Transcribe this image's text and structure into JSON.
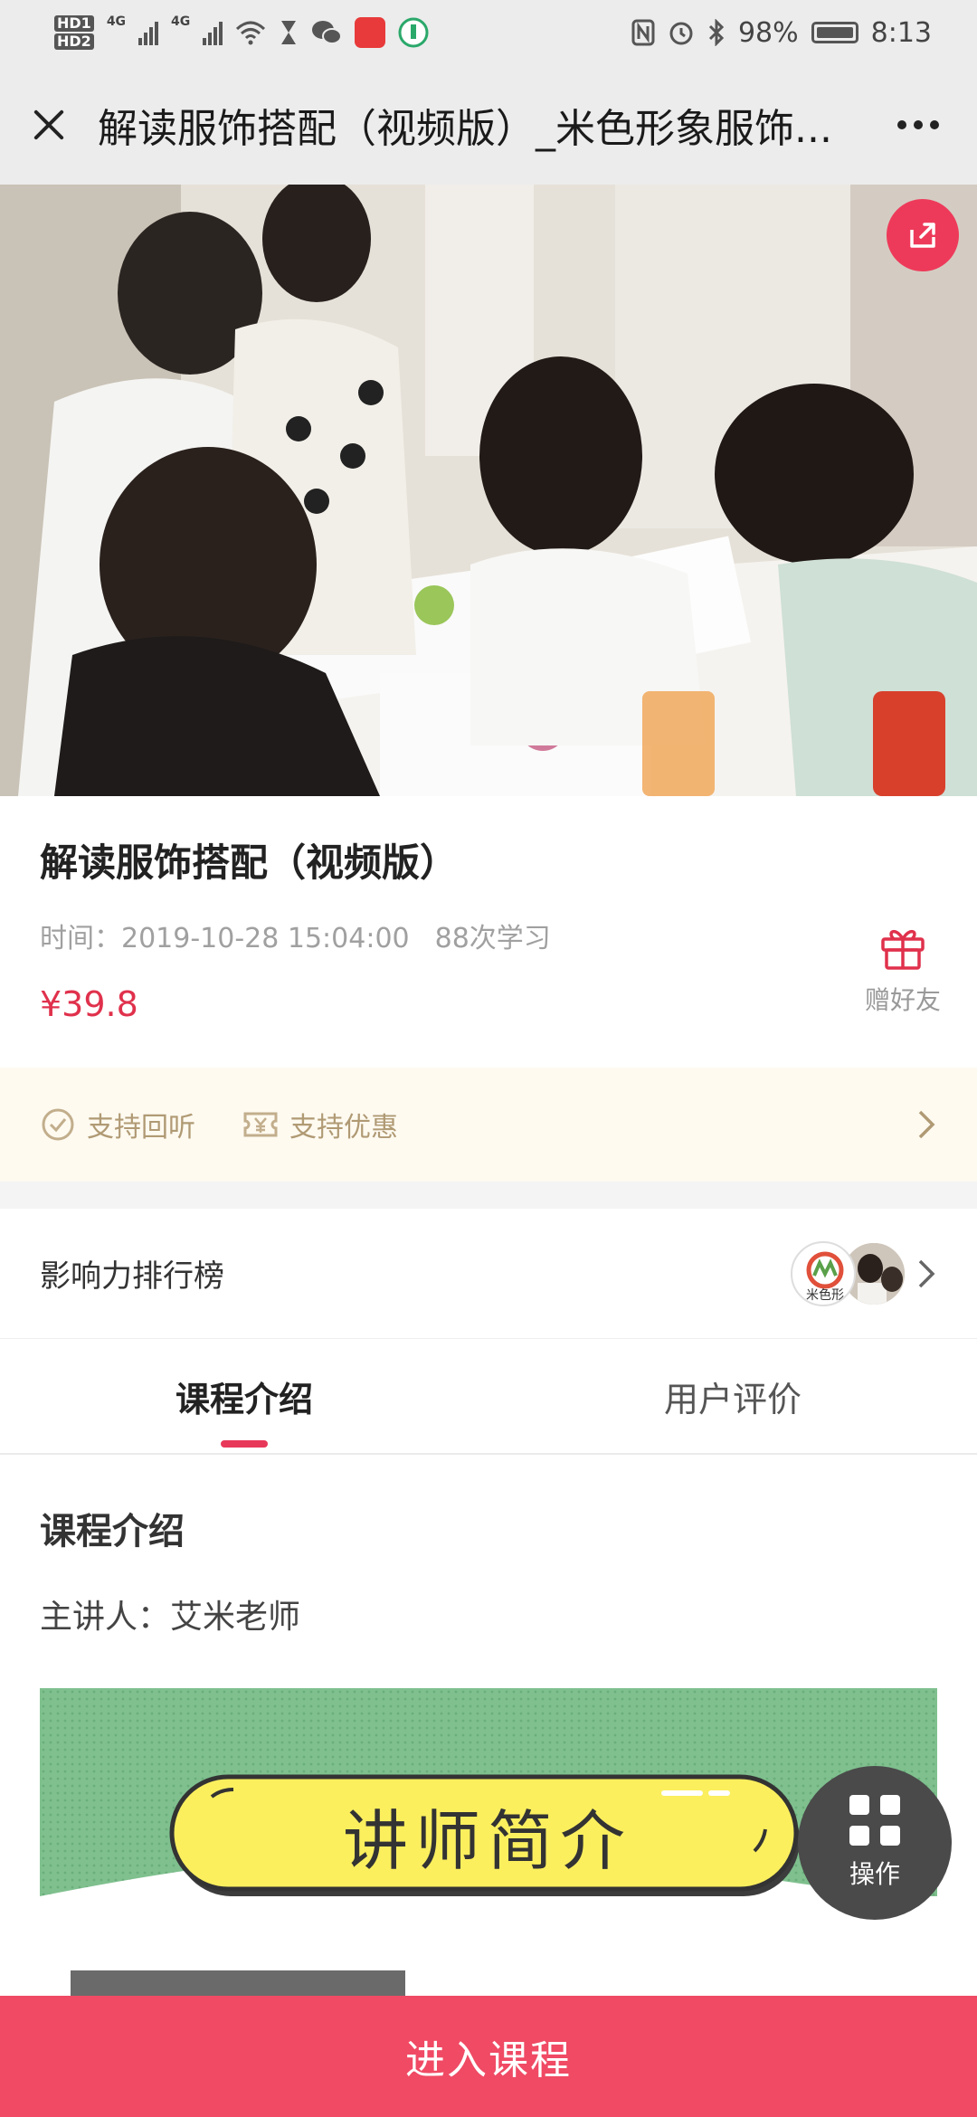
{
  "status_bar": {
    "network_1": "4G",
    "network_2": "4G",
    "battery": "98%",
    "time": "8:13"
  },
  "nav": {
    "title": "解读服饰搭配（视频版）_米色形象服饰..."
  },
  "course": {
    "title": "解读服饰搭配（视频版）",
    "time_label": "时间：2019-10-28 15:04:00",
    "learn_count": "88次学习",
    "price": "¥39.8",
    "gift_label": "赠好友"
  },
  "support": {
    "replay": "支持回听",
    "discount": "支持优惠"
  },
  "ranking": {
    "label": "影响力排行榜",
    "avatar_text": "米色形"
  },
  "tabs": [
    {
      "label": "课程介绍",
      "active": true
    },
    {
      "label": "用户评价",
      "active": false
    }
  ],
  "intro": {
    "heading": "课程介绍",
    "speaker": "主讲人：艾米老师",
    "banner_text": "讲师简介"
  },
  "fab": {
    "label": "操作"
  },
  "enter_button": {
    "label": "进入课程"
  },
  "colors": {
    "accent": "#e0314c",
    "button": "#f04a64",
    "support_bg": "#fefaf0",
    "support_text": "#b09a74",
    "banner_green": "#7fc08e",
    "banner_yellow": "#fbef5e"
  }
}
